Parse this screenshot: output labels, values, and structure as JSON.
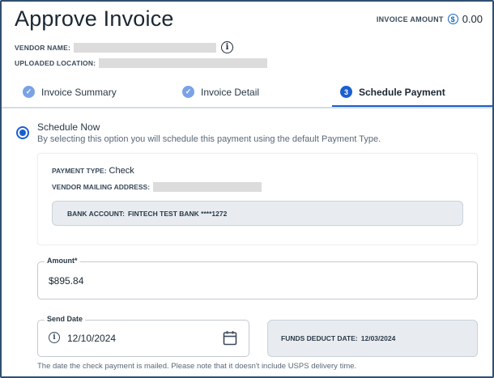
{
  "header": {
    "title": "Approve Invoice",
    "invoice_amount_label": "INVOICE AMOUNT",
    "currency_symbol": "$",
    "invoice_amount_value": "0.00",
    "vendor_name_label": "VENDOR NAME:",
    "uploaded_location_label": "UPLOADED LOCATION:"
  },
  "steps": [
    {
      "label": "Invoice Summary",
      "state": "complete"
    },
    {
      "label": "Invoice Detail",
      "state": "complete"
    },
    {
      "label": "Schedule Payment",
      "state": "active",
      "number": "3"
    }
  ],
  "schedule": {
    "option_title": "Schedule Now",
    "option_description": "By selecting this option you will schedule this payment using the default Payment Type.",
    "selected": true
  },
  "payment_card": {
    "payment_type_label": "PAYMENT TYPE:",
    "payment_type_value": "Check",
    "vendor_mailing_address_label": "VENDOR MAILING ADDRESS:",
    "bank_account_label": "BANK ACCOUNT:",
    "bank_account_value": "FINTECH TEST BANK ****1272"
  },
  "amount_field": {
    "label": "Amount*",
    "value": "$895.84"
  },
  "send_date": {
    "label": "Send Date",
    "value": "12/10/2024"
  },
  "funds_deduct": {
    "label": "FUNDS DEDUCT DATE:",
    "value": "12/03/2024"
  },
  "note": "The date the check payment is mailed. Please note that it doesn't include USPS delivery time.",
  "colors": {
    "accent": "#1a5fd0",
    "complete_step": "#7aa2e6",
    "readonly_bg": "#e8ecf0"
  }
}
